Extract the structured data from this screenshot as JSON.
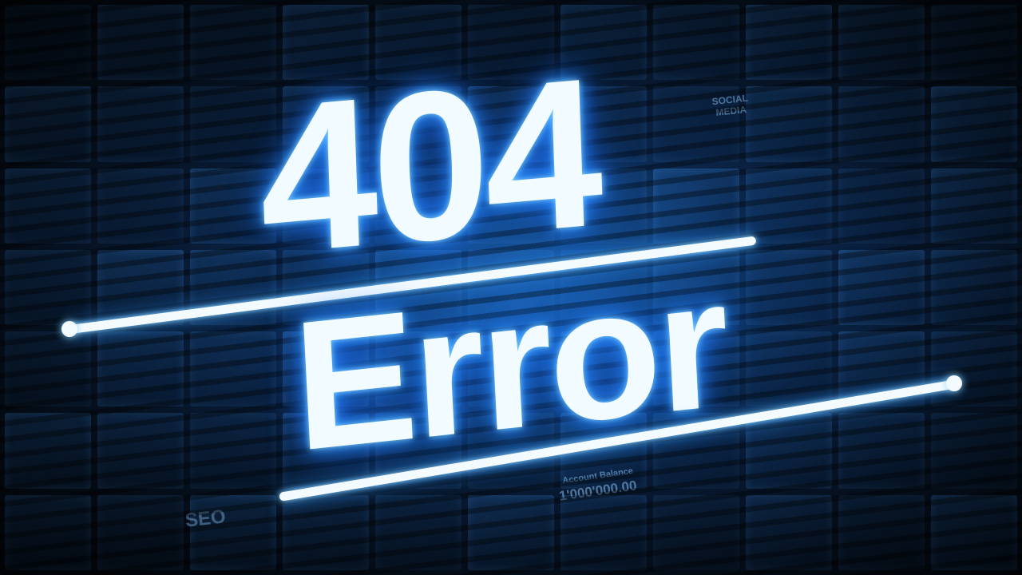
{
  "headline": {
    "code": "404",
    "word": "Error"
  },
  "background_labels": {
    "social": "SOCIAL MEDIA",
    "seo": "SEO",
    "account_title": "Account Balance",
    "account_value": "1'000'000.00"
  },
  "colors": {
    "text": "#f2fbff",
    "glow": "#2f95ff",
    "background": "#06111f"
  }
}
